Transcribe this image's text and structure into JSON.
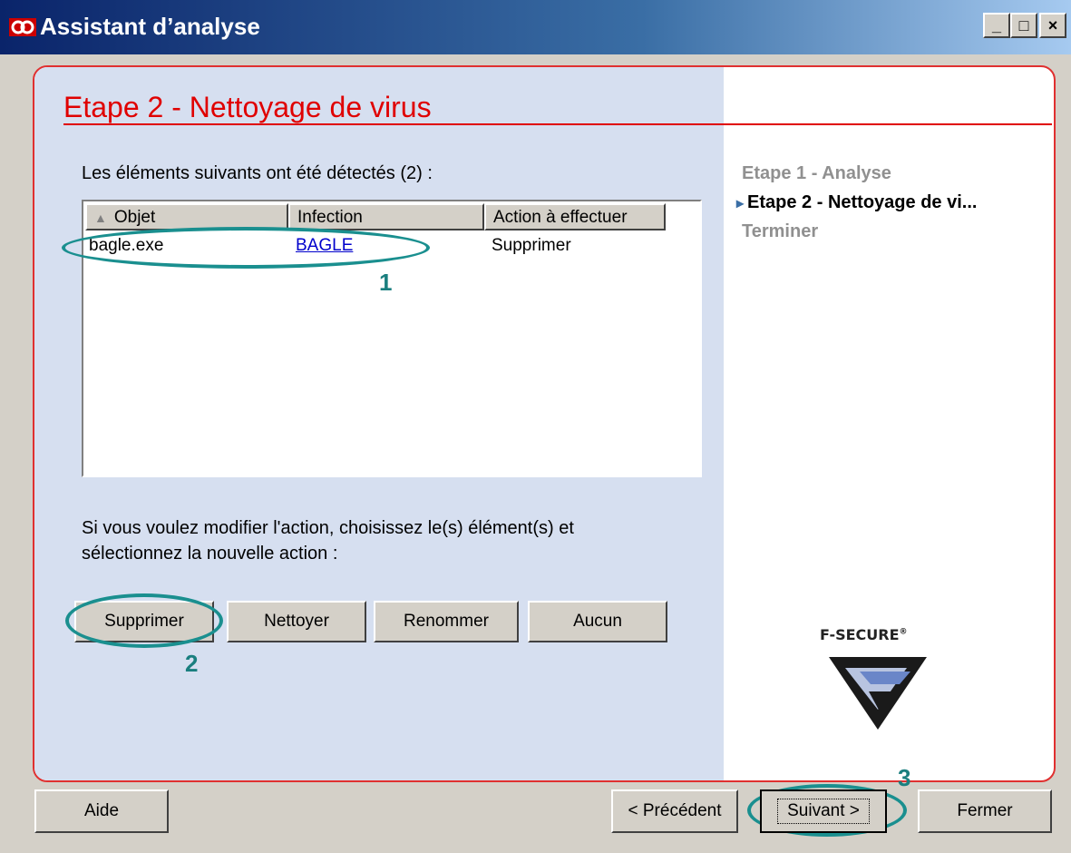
{
  "window": {
    "title": "Assistant d’analyse",
    "controls": [
      "_",
      "□",
      "×"
    ]
  },
  "step": {
    "title": "Etape 2 - Nettoyage de virus",
    "detected_label": "Les éléments suivants ont été détectés (2) :",
    "instructions_line1": "Si vous voulez modifier l'action, choisissez le(s) élément(s) et",
    "instructions_line2": "sélectionnez la nouvelle action :"
  },
  "table": {
    "headers": [
      "Objet",
      "Infection",
      "Action à effectuer"
    ],
    "sort_indicator": "▲",
    "rows": [
      {
        "objet": "bagle.exe",
        "infection": "BAGLE",
        "action": "Supprimer"
      }
    ]
  },
  "action_buttons": [
    "Supprimer",
    "Nettoyer",
    "Renommer",
    "Aucun"
  ],
  "nav": {
    "items": [
      {
        "label": "Etape 1 - Analyse",
        "state": "done"
      },
      {
        "label": "Etape 2 - Nettoyage de vi...",
        "state": "current"
      },
      {
        "label": "Terminer",
        "state": "pending"
      }
    ],
    "current_marker": "▸"
  },
  "brand": {
    "logo_text": "F-SECURE",
    "trademark": "®"
  },
  "annotations": [
    "1",
    "2",
    "3"
  ],
  "footer": {
    "help": "Aide",
    "previous": "< Précédent",
    "next": "Suivant >",
    "close": "Fermer"
  },
  "colors": {
    "accent_red": "#e00000",
    "annotation_teal": "#1a8f8f",
    "panel_blue": "#d6dff0",
    "link_blue": "#0000cc"
  }
}
